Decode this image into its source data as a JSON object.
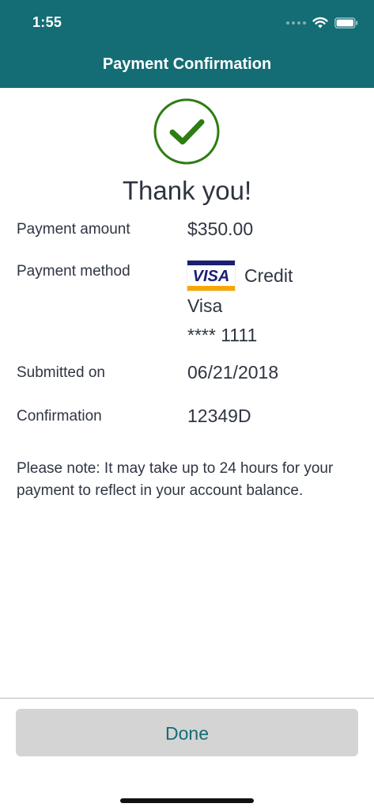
{
  "status_bar": {
    "time": "1:55"
  },
  "header": {
    "title": "Payment Confirmation"
  },
  "confirmation": {
    "heading": "Thank you!",
    "amount_label": "Payment amount",
    "amount_value": "$350.00",
    "method_label": "Payment method",
    "method_brand_logo": "VISA",
    "method_line1": "Credit",
    "method_line2": "Visa",
    "method_line3": "**** 1111",
    "submitted_label": "Submitted on",
    "submitted_value": "06/21/2018",
    "confirmation_label": "Confirmation",
    "confirmation_value": "12349D",
    "note": "Please note: It may take up to 24 hours for your payment to reflect in your account balance."
  },
  "footer": {
    "done_label": "Done"
  },
  "colors": {
    "brand": "#146d75",
    "success": "#2e7d12",
    "button_bg": "#d4d4d4"
  },
  "icons": {
    "success": "checkmark-circle-icon",
    "wifi": "wifi-icon",
    "battery": "battery-icon",
    "signal": "cellular-signal-icon",
    "card": "visa-card-icon"
  }
}
